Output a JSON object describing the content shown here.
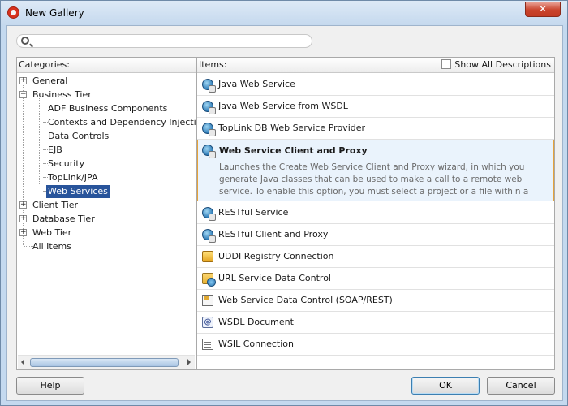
{
  "window": {
    "title": "New Gallery",
    "close_label": "✕"
  },
  "search": {
    "value": "",
    "placeholder": ""
  },
  "categories": {
    "header": "Categories:",
    "nodes": [
      {
        "label": "General",
        "expander": "+"
      },
      {
        "label": "Business Tier",
        "expander": "−"
      },
      {
        "label": "ADF Business Components"
      },
      {
        "label": "Contexts and Dependency Injection"
      },
      {
        "label": "Data Controls"
      },
      {
        "label": "EJB"
      },
      {
        "label": "Security"
      },
      {
        "label": "TopLink/JPA"
      },
      {
        "label": "Web Services",
        "selected": true
      },
      {
        "label": "Client Tier",
        "expander": "+"
      },
      {
        "label": "Database Tier",
        "expander": "+"
      },
      {
        "label": "Web Tier",
        "expander": "+"
      },
      {
        "label": "All Items"
      }
    ]
  },
  "items": {
    "header": "Items:",
    "show_all_label": "Show All Descriptions",
    "show_all_checked": false,
    "list": [
      {
        "label": "Java Web Service",
        "icon": "web-service-globe-icon"
      },
      {
        "label": "Java Web Service from WSDL",
        "icon": "web-service-globe-icon"
      },
      {
        "label": "TopLink DB Web Service Provider",
        "icon": "web-service-globe-icon"
      },
      {
        "label": "Web Service Client and Proxy",
        "icon": "web-service-globe-icon",
        "selected": true,
        "description": "Launches the Create Web Service Client and Proxy wizard, in which you generate Java classes that can be used to make a call to a remote web service. To enable this option, you must select a project or a file within a project in the Application"
      },
      {
        "label": "RESTful Service",
        "icon": "web-service-globe-icon"
      },
      {
        "label": "RESTful Client and Proxy",
        "icon": "web-service-globe-icon"
      },
      {
        "label": "UDDI Registry Connection",
        "icon": "uddi-registry-icon"
      },
      {
        "label": "URL Service Data Control",
        "icon": "url-data-control-icon"
      },
      {
        "label": "Web Service Data Control (SOAP/REST)",
        "icon": "soap-data-control-icon"
      },
      {
        "label": "WSDL Document",
        "icon": "wsdl-document-icon"
      },
      {
        "label": "WSIL Connection",
        "icon": "wsil-connection-icon"
      }
    ]
  },
  "buttons": {
    "help": "Help",
    "ok": "OK",
    "cancel": "Cancel"
  }
}
